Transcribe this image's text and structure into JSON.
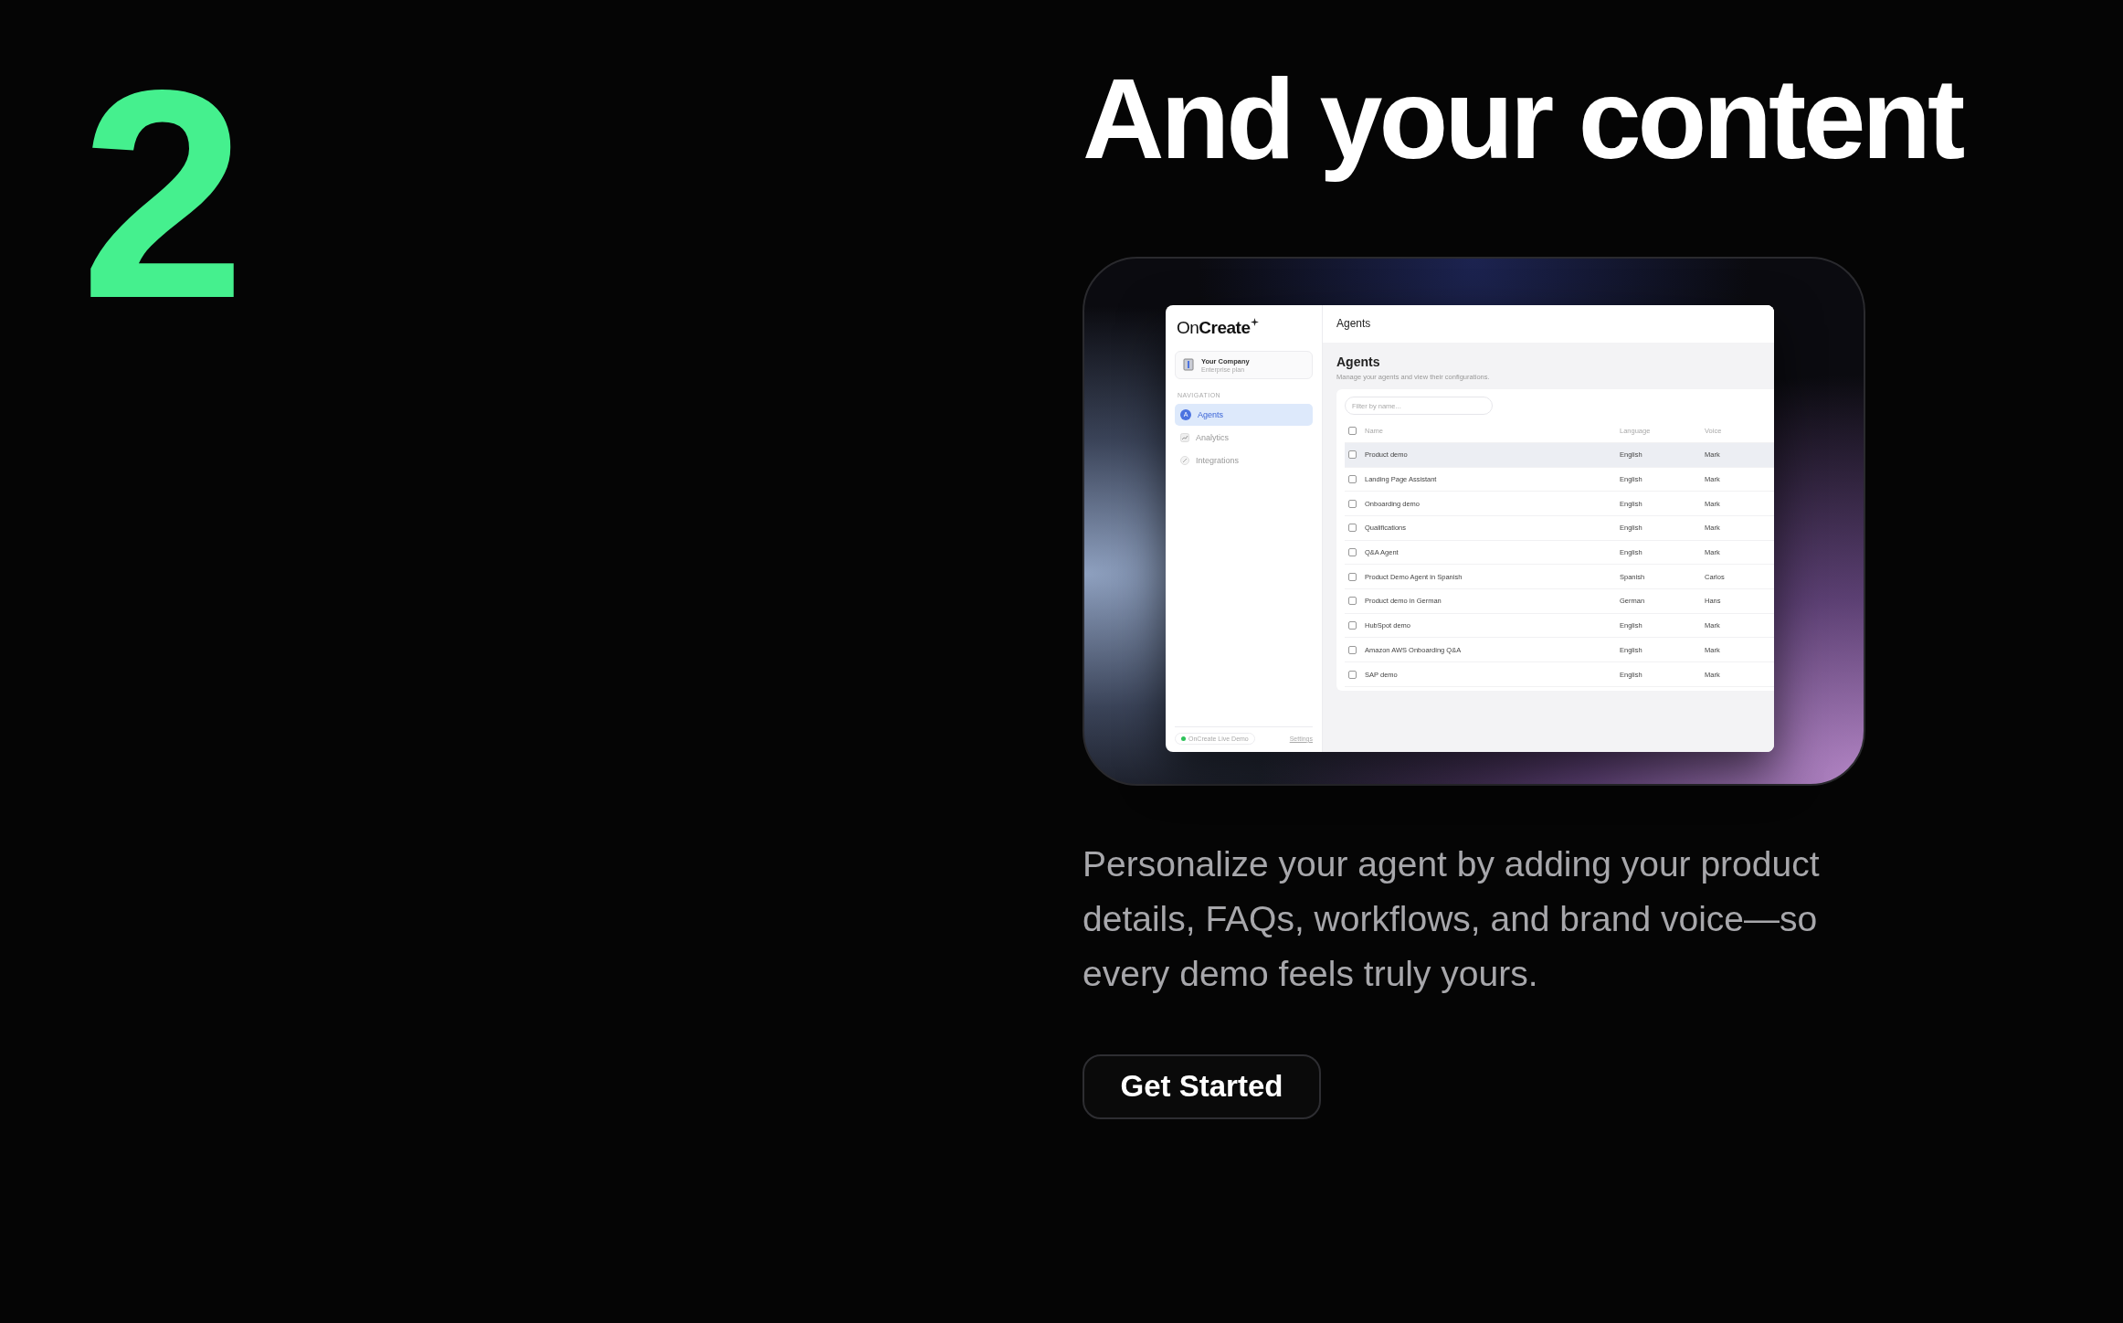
{
  "step_number": "2",
  "heading": "And your content",
  "preview": {
    "logo": "On**Create**",
    "company": {
      "name": "Your Company",
      "plan": "Enterprise plan"
    },
    "nav_heading": "NAVIGATION",
    "nav_items": [
      {
        "label": "Agents",
        "kind": "letter",
        "letter": "A",
        "selected": true
      },
      {
        "label": "Analytics",
        "kind": "chart",
        "selected": false
      },
      {
        "label": "Integrations",
        "kind": "link",
        "selected": false
      }
    ],
    "footer": {
      "status": "OnCreate Live Demo",
      "link": "Settings"
    },
    "topbar_title": "Agents",
    "page_title": "Agents",
    "page_subtitle": "Manage your agents and view their configurations.",
    "filter": {
      "placeholder": "Filter by name..."
    },
    "table": {
      "header_checked": false,
      "columns": [
        "Name",
        "Language",
        "Voice"
      ],
      "rows": [
        {
          "checked": false,
          "selected": true,
          "cells": [
            "Product demo",
            "English",
            "Mark"
          ]
        },
        {
          "checked": false,
          "selected": false,
          "cells": [
            "Landing Page Assistant",
            "English",
            "Mark"
          ]
        },
        {
          "checked": false,
          "selected": false,
          "cells": [
            "Onboarding demo",
            "English",
            "Mark"
          ]
        },
        {
          "checked": false,
          "selected": false,
          "cells": [
            "Qualifications",
            "English",
            "Mark"
          ]
        },
        {
          "checked": false,
          "selected": false,
          "cells": [
            "Q&A Agent",
            "English",
            "Mark"
          ]
        },
        {
          "checked": false,
          "selected": false,
          "cells": [
            "Product Demo Agent in Spanish",
            "Spanish",
            "Carlos"
          ]
        },
        {
          "checked": false,
          "selected": false,
          "cells": [
            "Product demo in German",
            "German",
            "Hans"
          ]
        },
        {
          "checked": false,
          "selected": false,
          "cells": [
            "HubSpot demo",
            "English",
            "Mark"
          ]
        },
        {
          "checked": false,
          "selected": false,
          "cells": [
            "Amazon AWS Onboarding Q&A",
            "English",
            "Mark"
          ]
        },
        {
          "checked": false,
          "selected": false,
          "cells": [
            "SAP demo",
            "English",
            "Mark"
          ]
        }
      ]
    }
  },
  "description": "Personalize your agent by adding your product details, FAQs, workflows, and brand voice—so every demo feels truly yours.",
  "cta": "Get Started"
}
